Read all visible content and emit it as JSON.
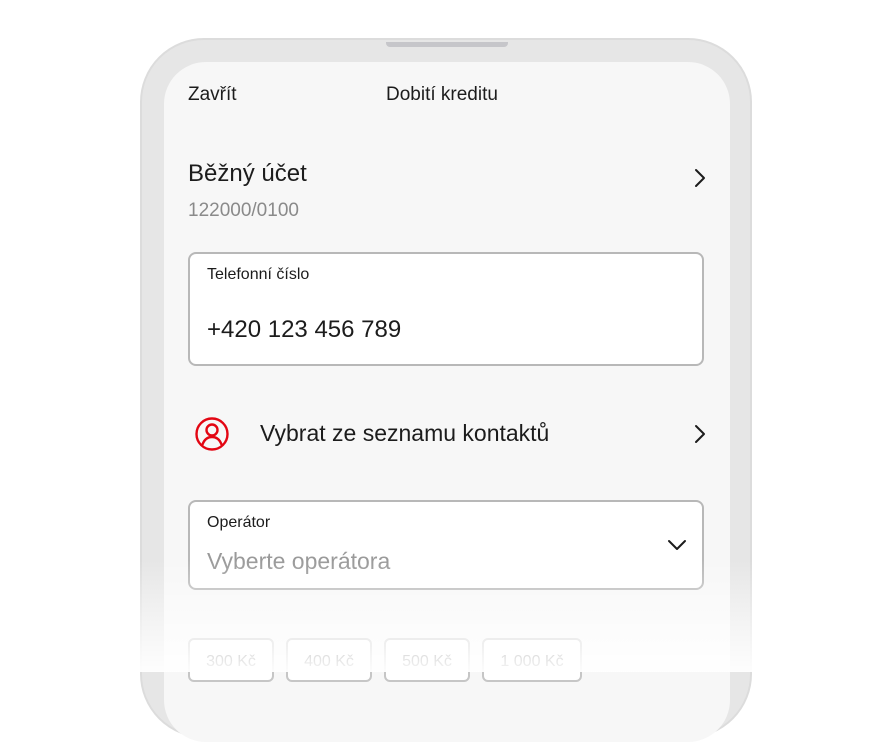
{
  "header": {
    "close_label": "Zavřít",
    "title": "Dobití kreditu"
  },
  "account": {
    "name": "Běžný účet",
    "number": "122000/0100"
  },
  "phone_field": {
    "label": "Telefonní číslo",
    "value": "+420 123 456 789"
  },
  "contacts": {
    "label": "Vybrat ze seznamu kontaktů"
  },
  "operator_field": {
    "label": "Operátor",
    "placeholder": "Vyberte operátora"
  },
  "amounts": [
    "300 Kč",
    "400 Kč",
    "500 Kč",
    "1 000 Kč"
  ],
  "colors": {
    "accent": "#e30613",
    "text": "#1c1c1c",
    "muted": "#8a8a8a",
    "screen_bg": "#f7f7f7"
  },
  "icons": {
    "account_chevron": "chevron-right-icon",
    "contacts_icon": "user-circle-icon",
    "contacts_chevron": "chevron-right-icon",
    "operator_chevron": "chevron-down-icon"
  }
}
